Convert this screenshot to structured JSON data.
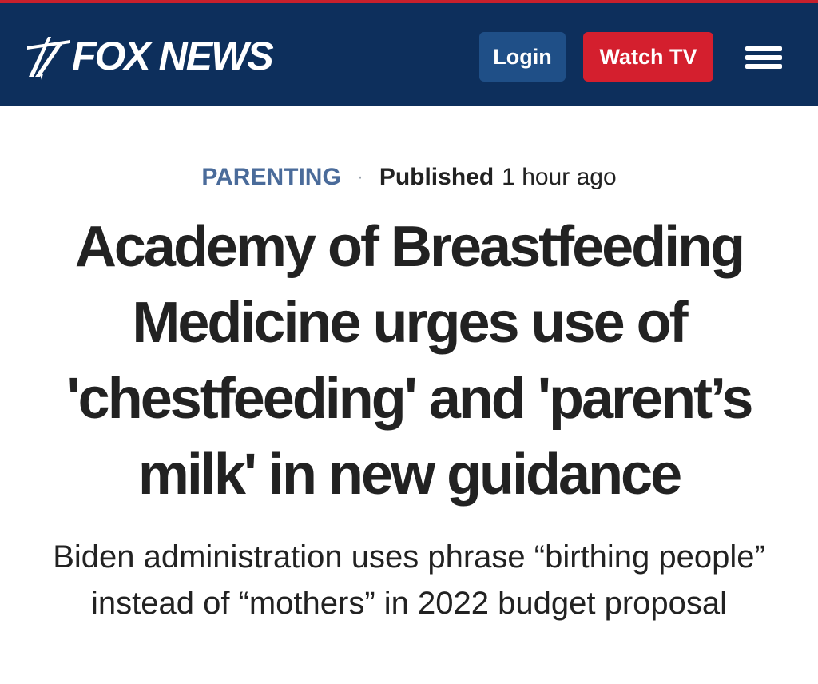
{
  "header": {
    "logo_text": "FOX NEWS",
    "login_label": "Login",
    "watch_tv_label": "Watch TV",
    "menu_icon": "hamburger-menu-icon",
    "colors": {
      "header_bg": "#0d2f5c",
      "login_bg": "#1f4f87",
      "watch_tv_bg": "#d41f2e",
      "top_strip": "#c7202c"
    }
  },
  "article": {
    "category": "PARENTING",
    "separator": "·",
    "published_label": "Published",
    "published_time": "1 hour ago",
    "headline": "Academy of Breastfeeding Medicine urges use of 'chestfeeding' and 'parent’s milk' in new guidance",
    "subheadline": "Biden administration uses phrase “birthing people” instead of “mothers” in 2022 budget proposal",
    "colors": {
      "category": "#4a6b9a",
      "text": "#222222"
    }
  }
}
